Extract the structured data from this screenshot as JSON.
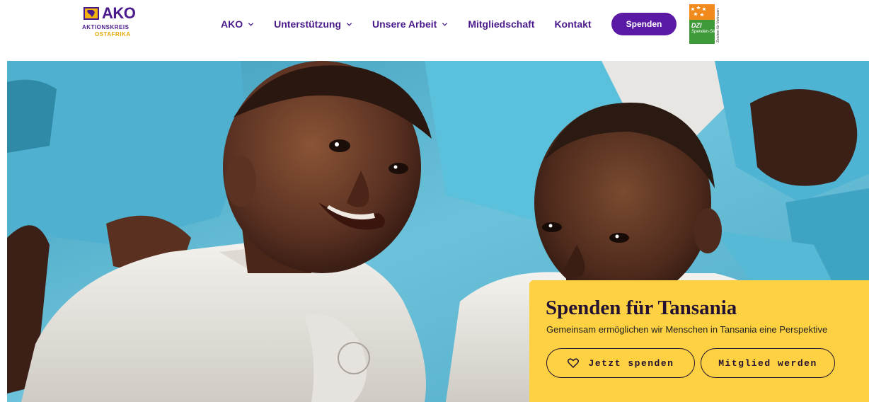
{
  "header": {
    "logo": {
      "word": "AKO",
      "line1": "AKTIONSKREIS",
      "line2": "OSTAFRIKA"
    },
    "nav": [
      {
        "label": "AKO",
        "has_dropdown": true
      },
      {
        "label": "Unterstützung",
        "has_dropdown": true
      },
      {
        "label": "Unsere Arbeit",
        "has_dropdown": true
      },
      {
        "label": "Mitgliedschaft",
        "has_dropdown": false
      },
      {
        "label": "Kontakt",
        "has_dropdown": false
      }
    ],
    "donate_label": "Spenden",
    "seal": {
      "mark": "DZI",
      "text": "Spenden-Siegel",
      "side": "Zeichen für Vertrauen"
    }
  },
  "hero": {
    "image": "photo of smiling children in blue and white school uniforms",
    "card": {
      "title": "Spenden für Tansania",
      "subtitle": "Gemeinsam ermöglichen wir Menschen in Tansania eine Perspektive",
      "donate_button": "Jetzt spenden",
      "member_button": "Mitglied werden"
    }
  },
  "colors": {
    "brand_purple": "#4a1a8c",
    "button_purple": "#5b1aa5",
    "card_yellow": "#fed143",
    "logo_orange": "#e6a800"
  },
  "icons": {
    "nav_dropdown": "chevron-down-icon",
    "donate_heart": "heart-icon"
  }
}
